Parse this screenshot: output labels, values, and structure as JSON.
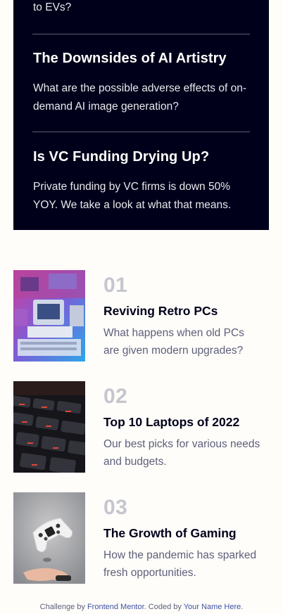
{
  "new_section": {
    "partial_text": "to EVs?",
    "items": [
      {
        "title": "The Downsides of AI Artistry",
        "description": "What are the possible adverse effects of on-demand AI image generation?"
      },
      {
        "title": "Is VC Funding Drying Up?",
        "description": "Private funding by VC firms is down 50% YOY. We take a look at what that means."
      }
    ]
  },
  "articles": [
    {
      "number": "01",
      "title": "Reviving Retro PCs",
      "description": "What happens when old PCs are given modern upgrades?",
      "image_icon": "retro-pc-image"
    },
    {
      "number": "02",
      "title": "Top 10 Laptops of 2022",
      "description": "Our best picks for various needs and budgets.",
      "image_icon": "keyboard-image"
    },
    {
      "number": "03",
      "title": "The Growth of Gaming",
      "description": "How the pandemic has sparked fresh opportunities.",
      "image_icon": "gamepad-image"
    }
  ],
  "footer": {
    "prefix": "Challenge by",
    "link1": "Frontend Mentor",
    "middle": ". Coded by",
    "link2": "Your Name Here",
    "suffix": "."
  },
  "colors": {
    "dark_panel": "#00001a",
    "background": "#fffdfa",
    "number_gray": "#c5c6ce",
    "muted_text": "#5d5f79"
  }
}
